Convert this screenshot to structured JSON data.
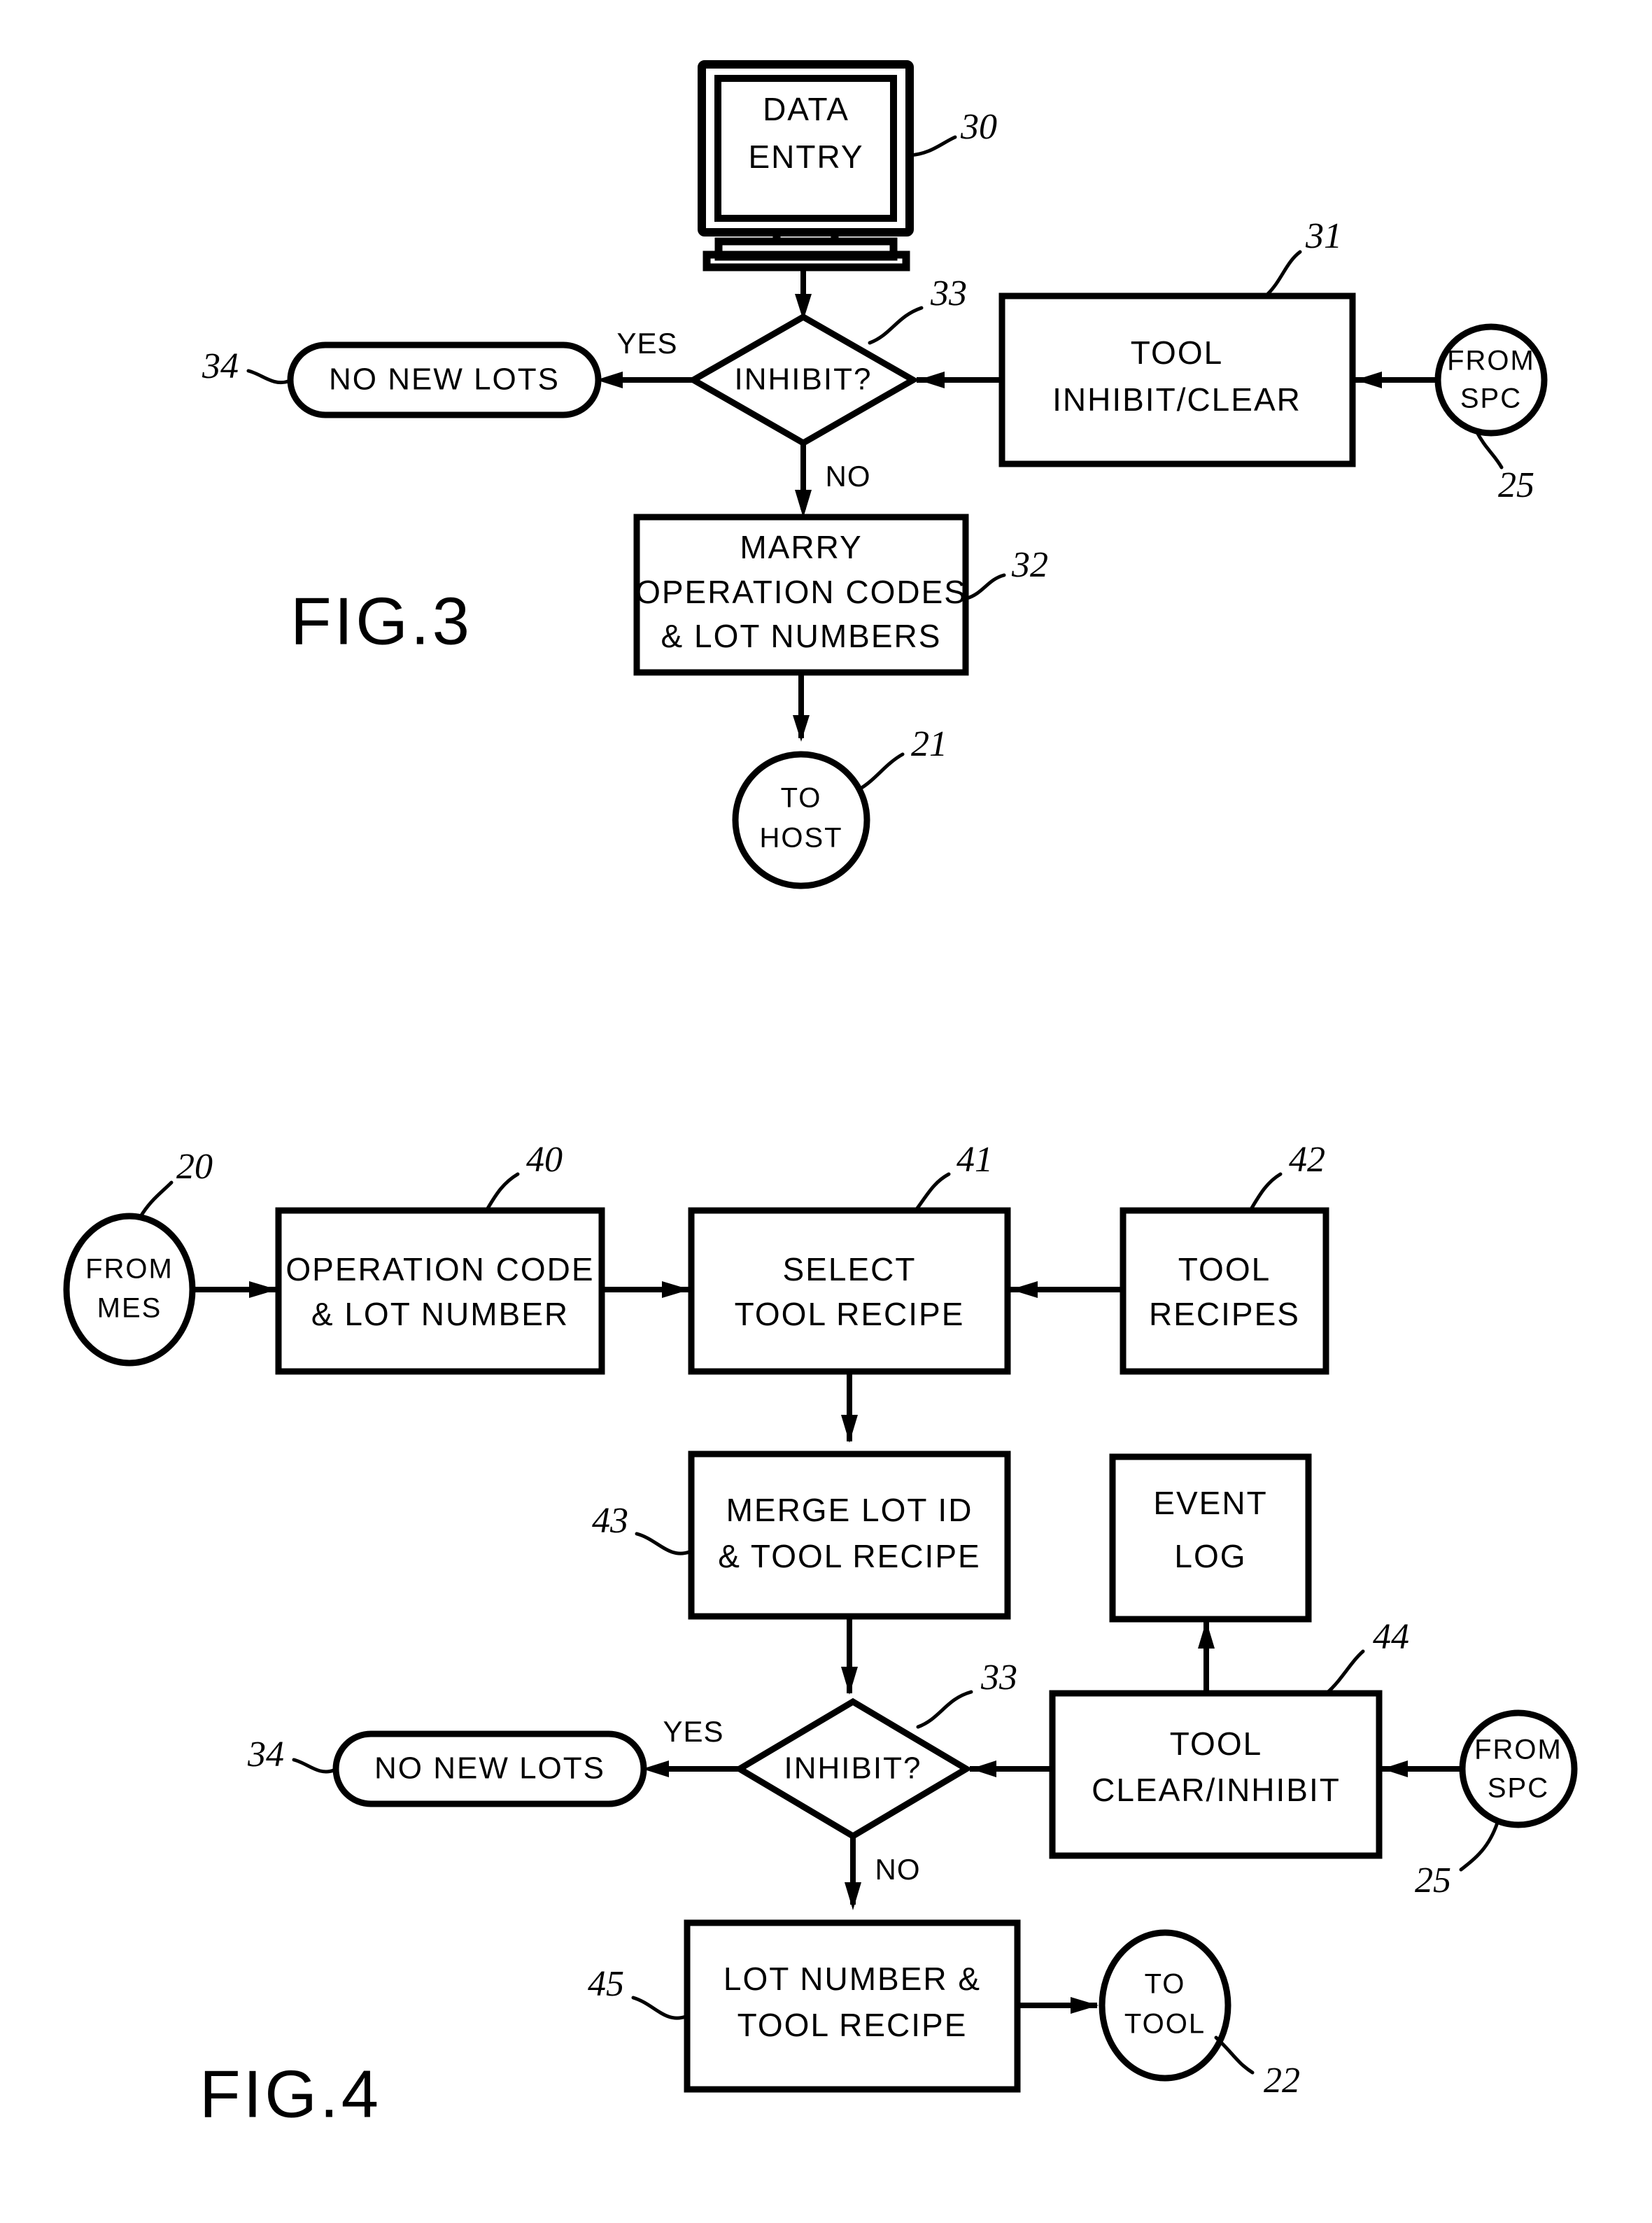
{
  "document": {
    "type": "patent-drawing-sheet",
    "figures": [
      "FIG.3",
      "FIG.4"
    ]
  },
  "fig3": {
    "title": "FIG.3",
    "nodes": {
      "data_entry": {
        "label_line1": "DATA",
        "label_line2": "ENTRY",
        "ref": "30",
        "shape": "monitor"
      },
      "inhibit": {
        "label": "INHIBIT?",
        "ref": "33",
        "shape": "diamond"
      },
      "no_new_lots": {
        "label": "NO NEW LOTS",
        "ref": "34",
        "shape": "stadium"
      },
      "tool_inhibit_clear": {
        "label_line1": "TOOL",
        "label_line2": "INHIBIT/CLEAR",
        "ref": "31",
        "shape": "rect"
      },
      "from_spc": {
        "label_line1": "FROM",
        "label_line2": "SPC",
        "ref": "25",
        "shape": "circle"
      },
      "marry": {
        "label_line1": "MARRY",
        "label_line2": "OPERATION CODES",
        "label_line3": "& LOT NUMBERS",
        "ref": "32",
        "shape": "rect"
      },
      "to_host": {
        "label_line1": "TO",
        "label_line2": "HOST",
        "ref": "21",
        "shape": "circle"
      }
    },
    "edge_labels": {
      "yes": "YES",
      "no": "NO"
    }
  },
  "fig4": {
    "title": "FIG.4",
    "nodes": {
      "from_mes": {
        "label_line1": "FROM",
        "label_line2": "MES",
        "ref": "20",
        "shape": "ellipse"
      },
      "op_code_lot": {
        "label_line1": "OPERATION CODE",
        "label_line2": "& LOT NUMBER",
        "ref": "40",
        "shape": "rect"
      },
      "select_recipe": {
        "label_line1": "SELECT",
        "label_line2": "TOOL RECIPE",
        "ref": "41",
        "shape": "rect"
      },
      "tool_recipes": {
        "label_line1": "TOOL",
        "label_line2": "RECIPES",
        "ref": "42",
        "shape": "rect"
      },
      "merge": {
        "label_line1": "MERGE LOT ID",
        "label_line2": "& TOOL RECIPE",
        "ref": "43",
        "shape": "rect"
      },
      "event_log": {
        "label_line1": "EVENT",
        "label_line2": "LOG",
        "ref": "",
        "shape": "rect"
      },
      "inhibit": {
        "label": "INHIBIT?",
        "ref": "33",
        "shape": "diamond"
      },
      "no_new_lots": {
        "label": "NO NEW LOTS",
        "ref": "34",
        "shape": "stadium"
      },
      "tool_clear_inhibit": {
        "label_line1": "TOOL",
        "label_line2": "CLEAR/INHIBIT",
        "ref": "44",
        "shape": "rect"
      },
      "from_spc": {
        "label_line1": "FROM",
        "label_line2": "SPC",
        "ref": "25",
        "shape": "circle"
      },
      "lot_recipe": {
        "label_line1": "LOT NUMBER &",
        "label_line2": "TOOL RECIPE",
        "ref": "45",
        "shape": "rect"
      },
      "to_tool": {
        "label_line1": "TO",
        "label_line2": "TOOL",
        "ref": "22",
        "shape": "ellipse"
      }
    },
    "edge_labels": {
      "yes": "YES",
      "no": "NO"
    }
  },
  "colors": {
    "ink": "#000000",
    "paper": "#ffffff"
  }
}
